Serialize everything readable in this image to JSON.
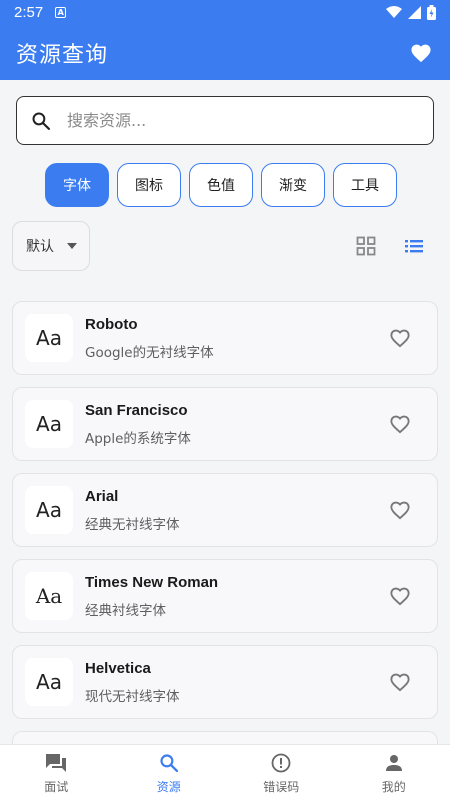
{
  "status_bar": {
    "time": "2:57",
    "notif_icon": "A"
  },
  "app_bar": {
    "title": "资源查询"
  },
  "search": {
    "placeholder": "搜索资源..."
  },
  "categories": [
    "字体",
    "图标",
    "色值",
    "渐变",
    "工具"
  ],
  "active_category": "字体",
  "sort": {
    "selected": "默认"
  },
  "fonts": [
    {
      "preview": "Aa",
      "name": "Roboto",
      "desc": "Google的无衬线字体"
    },
    {
      "preview": "Aa",
      "name": "San Francisco",
      "desc": "Apple的系统字体"
    },
    {
      "preview": "Aa",
      "name": "Arial",
      "desc": "经典无衬线字体"
    },
    {
      "preview": "Aa",
      "name": "Times New Roman",
      "desc": "经典衬线字体"
    },
    {
      "preview": "Aa",
      "name": "Helvetica",
      "desc": "现代无衬线字体"
    }
  ],
  "bottom_nav": [
    {
      "label": "面试",
      "icon": "chat-icon"
    },
    {
      "label": "资源",
      "icon": "search-icon"
    },
    {
      "label": "错误码",
      "icon": "alert-icon"
    },
    {
      "label": "我的",
      "icon": "person-icon"
    }
  ],
  "colors": {
    "primary": "#3b7df0",
    "background": "#f4f5f7"
  }
}
